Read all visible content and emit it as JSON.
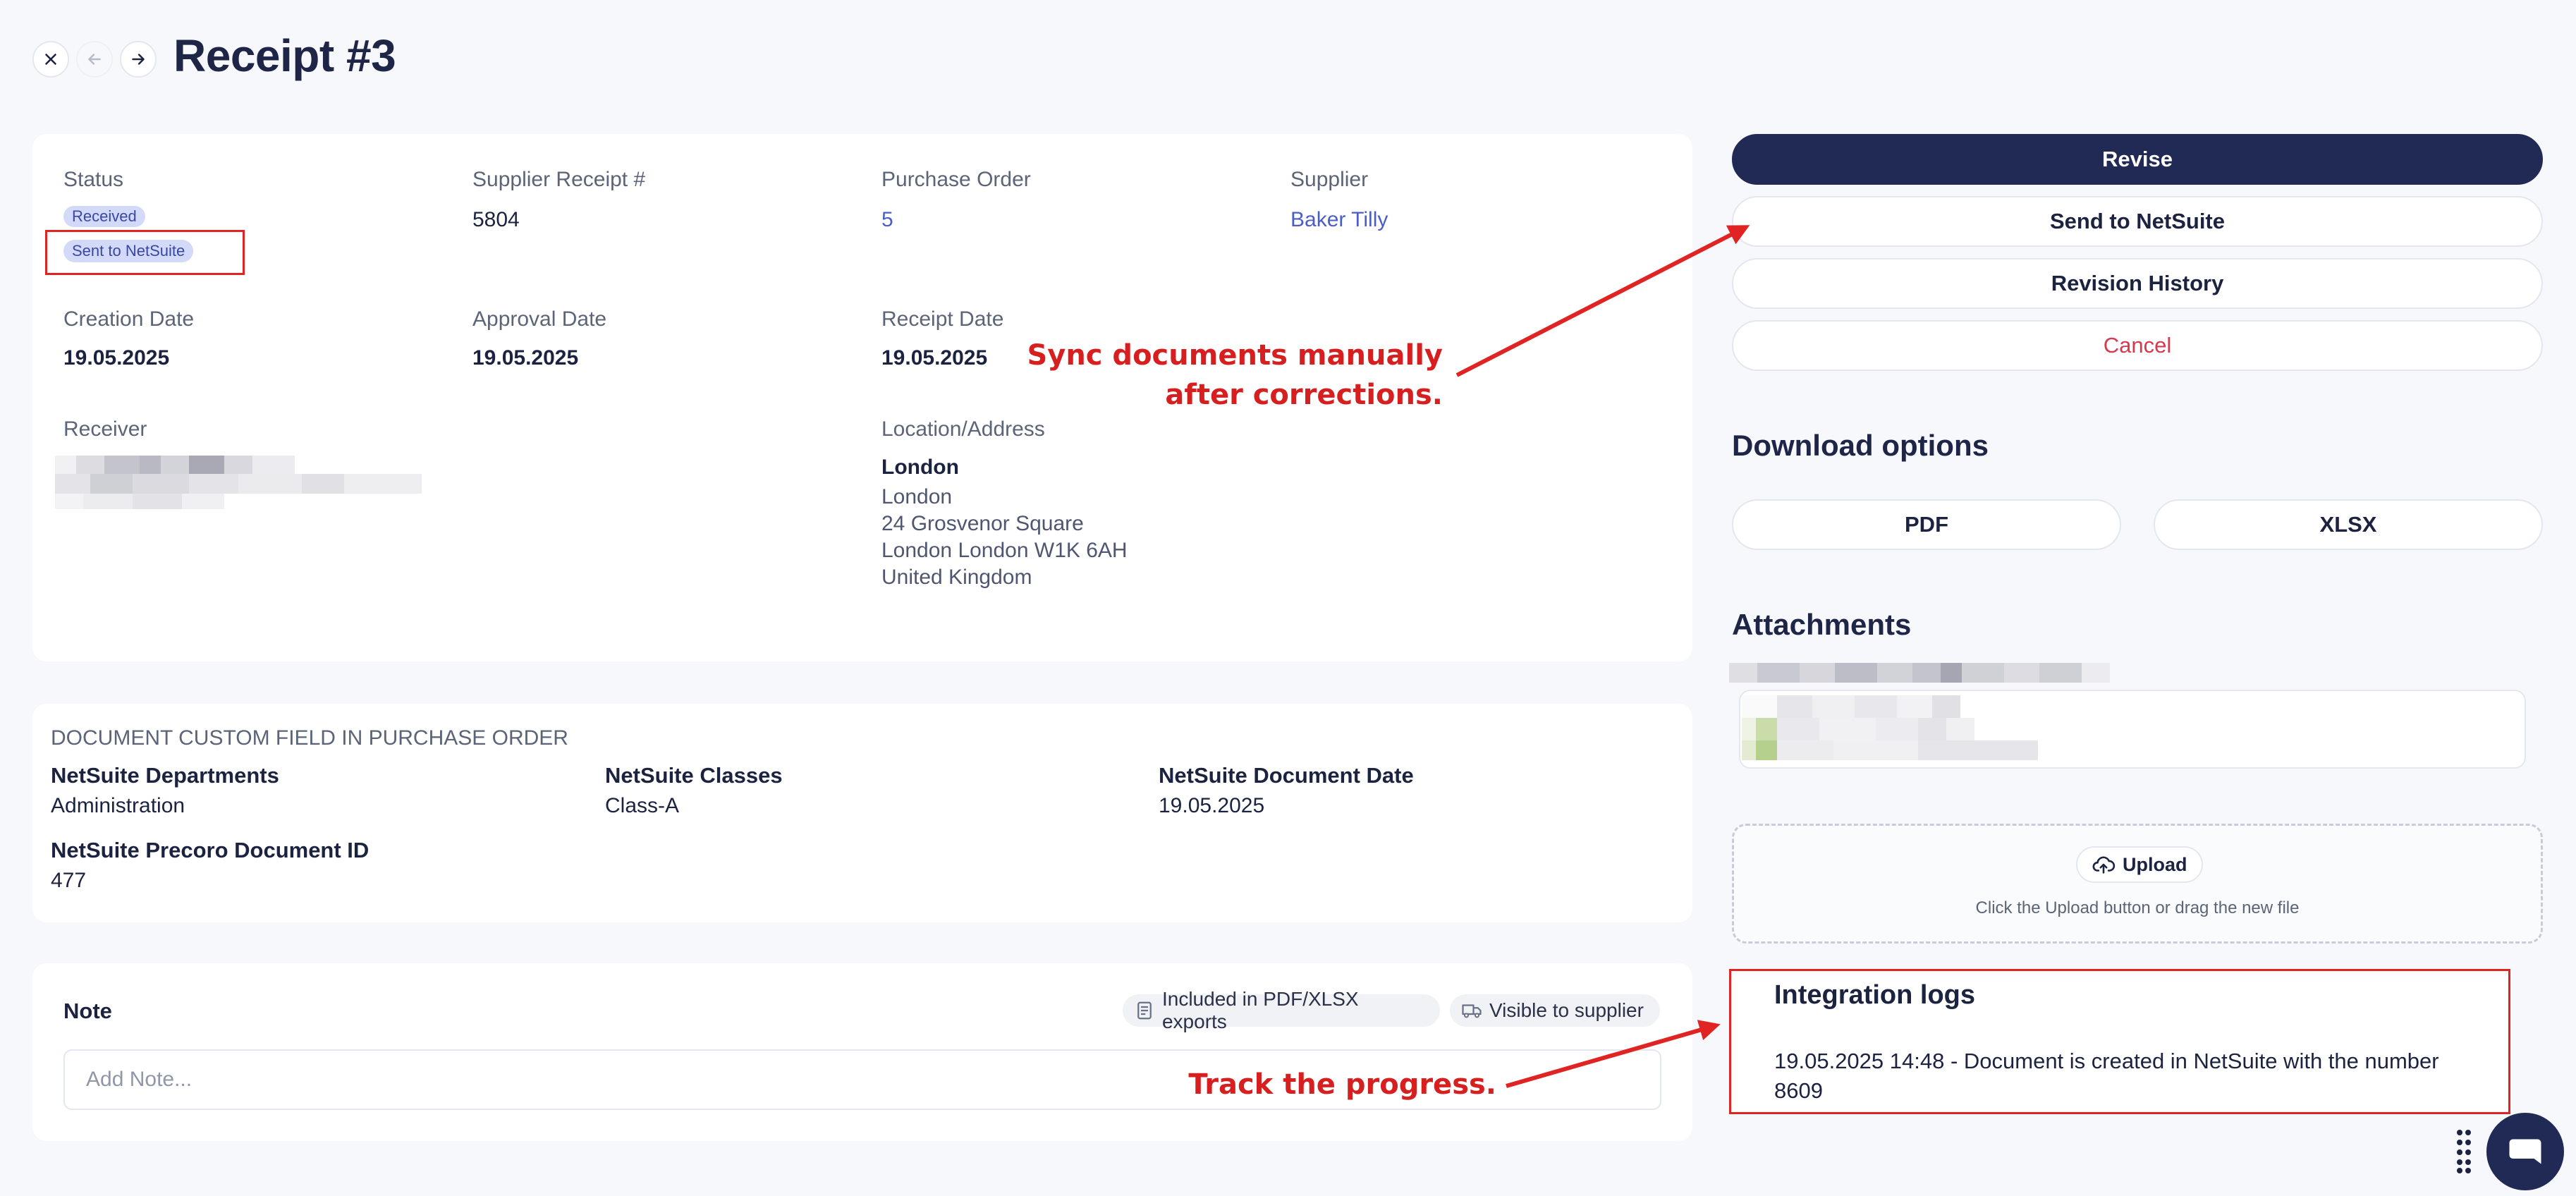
{
  "header": {
    "title": "Receipt #3"
  },
  "details": {
    "status_label": "Status",
    "status_badges": [
      "Received",
      "Sent to NetSuite"
    ],
    "supplier_receipt_label": "Supplier Receipt #",
    "supplier_receipt_value": "5804",
    "purchase_order_label": "Purchase Order",
    "purchase_order_value": "5",
    "supplier_label": "Supplier",
    "supplier_value": "Baker Tilly",
    "creation_date_label": "Creation Date",
    "creation_date_value": "19.05.2025",
    "approval_date_label": "Approval Date",
    "approval_date_value": "19.05.2025",
    "receipt_date_label": "Receipt Date",
    "receipt_date_value": "19.05.2025",
    "receiver_label": "Receiver",
    "location_label": "Location/Address",
    "location_name": "London",
    "location_lines": [
      "London",
      "24 Grosvenor Square",
      "London London W1K 6AH",
      "United Kingdom"
    ]
  },
  "custom_fields": {
    "section_title": "DOCUMENT CUSTOM FIELD IN PURCHASE ORDER",
    "fields": [
      {
        "label": "NetSuite Departments",
        "value": "Administration"
      },
      {
        "label": "NetSuite Classes",
        "value": "Class-A"
      },
      {
        "label": "NetSuite Document Date",
        "value": "19.05.2025"
      },
      {
        "label": "NetSuite Precoro Document ID",
        "value": "477"
      }
    ]
  },
  "note": {
    "label": "Note",
    "placeholder": "Add Note...",
    "tags": [
      "Included in PDF/XLSX exports",
      "Visible to supplier"
    ]
  },
  "actions": {
    "revise": "Revise",
    "send": "Send to NetSuite",
    "history": "Revision History",
    "cancel": "Cancel"
  },
  "download": {
    "title": "Download options",
    "pdf": "PDF",
    "xlsx": "XLSX"
  },
  "attachments": {
    "title": "Attachments",
    "upload_label": "Upload",
    "upload_hint": "Click the Upload button or drag the new file"
  },
  "integration_logs": {
    "title": "Integration logs",
    "entry": "19.05.2025 14:48 - Document is created in NetSuite with the number 8609"
  },
  "annotations": {
    "sync_line1": "Sync documents manually",
    "sync_line2": "after corrections.",
    "track": "Track the progress."
  },
  "colors": {
    "primary": "#212a54",
    "annotation_red": "#d81f1f",
    "link": "#4b5ec8",
    "danger": "#d63a4e"
  },
  "icons": {
    "close": "close-icon",
    "back": "arrow-left-icon",
    "forward": "arrow-right-icon",
    "upload": "cloud-upload-icon",
    "export": "document-icon",
    "supplier": "truck-icon",
    "chat": "chat-icon"
  }
}
